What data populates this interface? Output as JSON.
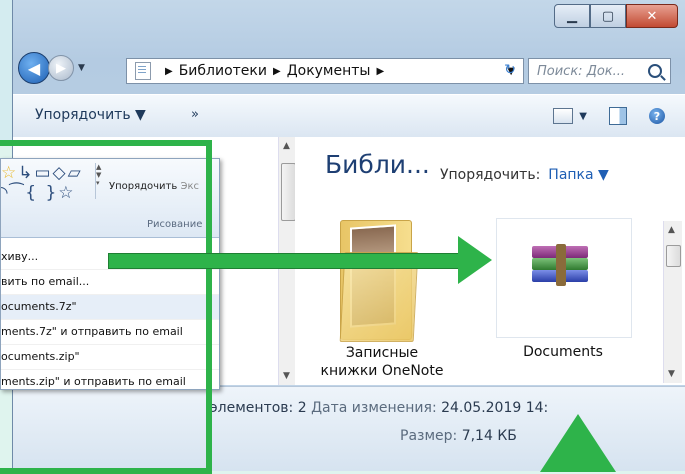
{
  "window": {
    "caption": {
      "min": "▁",
      "max": "▢",
      "close": "✕"
    },
    "breadcrumb": [
      "Библиотеки",
      "Документы"
    ],
    "search_placeholder": "Поиск: Док...",
    "toolbar": {
      "organize": "Упорядочить ▼",
      "more": "»"
    },
    "library_title": "Библи...",
    "arrange_label": "Упорядочить:",
    "arrange_value": "Папка ▼",
    "items": [
      {
        "name": "Записные книжки OneNote",
        "icon": "folder-icon"
      },
      {
        "name": "Documents",
        "icon": "winrar-archive-icon"
      }
    ],
    "status": {
      "count": "элементов: 2",
      "date_label": "Дата изменения:",
      "date_value": "24.05.2019 14:",
      "size_label": "Размер:",
      "size_value": "7,14 КБ"
    }
  },
  "popup": {
    "ribbon_organize": "Упорядочить",
    "ribbon_partial": "Экс",
    "ribbon_group": "Рисование",
    "menu": [
      "хиву...",
      "вить по email...",
      "ocuments.7z\"",
      "ments.7z\" и отправить по email",
      "ocuments.zip\"",
      "ments.zip\" и отправить по email"
    ]
  },
  "colors": {
    "annotation": "#2eb34a",
    "title": "#1e3f73"
  }
}
